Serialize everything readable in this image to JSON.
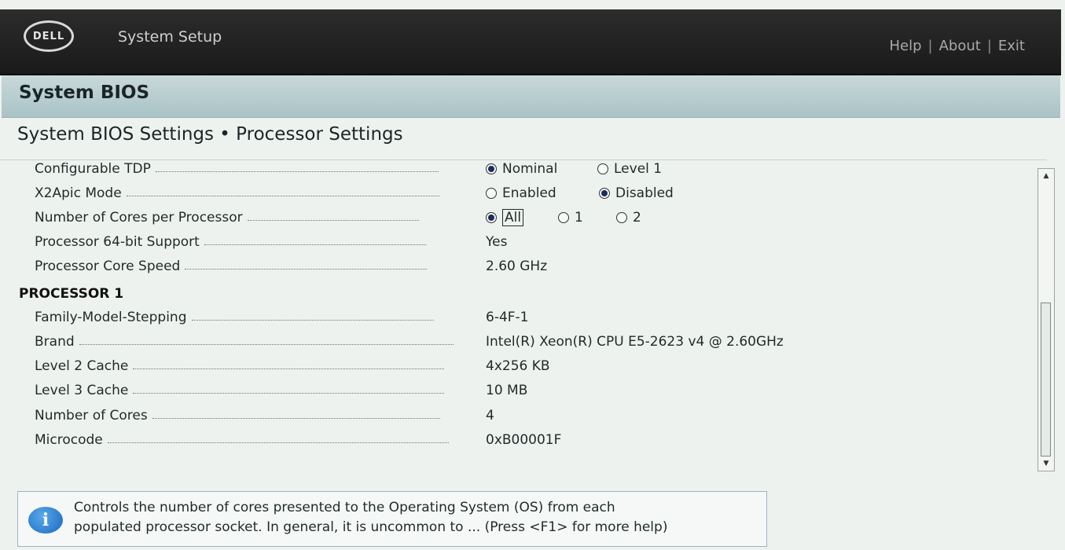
{
  "header": {
    "logo_text": "DELL",
    "app_title": "System Setup",
    "nav": [
      "Help",
      "About",
      "Exit"
    ]
  },
  "section": {
    "title": "System BIOS"
  },
  "page": {
    "title": "System BIOS Settings • Processor Settings"
  },
  "settings": [
    {
      "label": "Configurable TDP",
      "type": "radio",
      "options": [
        "Nominal",
        "Level 1"
      ],
      "selected": 0
    },
    {
      "label": "X2Apic Mode",
      "type": "radio",
      "options": [
        "Enabled",
        "Disabled"
      ],
      "selected": 1
    },
    {
      "label": "Number of Cores per Processor",
      "type": "radio",
      "options": [
        "All",
        "1",
        "2"
      ],
      "selected": 0
    },
    {
      "label": "Processor 64-bit Support",
      "type": "text",
      "value": "Yes"
    },
    {
      "label": "Processor Core Speed",
      "type": "text",
      "value": "2.60 GHz"
    }
  ],
  "processor1": {
    "header": "PROCESSOR 1",
    "rows": [
      {
        "label": "Family-Model-Stepping",
        "value": "6-4F-1"
      },
      {
        "label": "Brand",
        "value": "Intel(R) Xeon(R) CPU E5-2623 v4 @ 2.60GHz"
      },
      {
        "label": "Level 2 Cache",
        "value": "4x256 KB"
      },
      {
        "label": "Level 3 Cache",
        "value": "10 MB"
      },
      {
        "label": "Number of Cores",
        "value": "4"
      },
      {
        "label": "Microcode",
        "value": "0xB00001F"
      }
    ]
  },
  "help": {
    "line1": "Controls the number of cores presented to the Operating System (OS) from each",
    "line2": "populated processor socket. In general, it is uncommon to ... (Press <F1> for more help)"
  },
  "icons": {
    "info": "info-icon",
    "scroll_up": "arrow-up-icon",
    "scroll_down": "arrow-down-icon"
  }
}
